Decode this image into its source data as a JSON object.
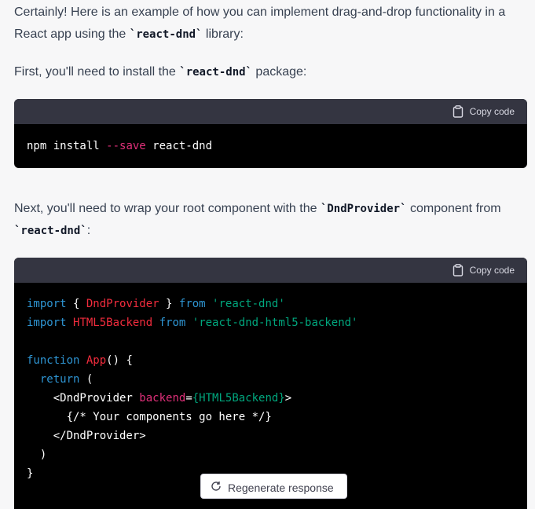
{
  "intro": {
    "before": "Certainly! Here is an example of how you can implement drag-and-drop functionality in a React app using the ",
    "lib": "`react-dnd`",
    "after": " library:"
  },
  "install": {
    "before": "First, you'll need to install the ",
    "lib": "`react-dnd`",
    "after": " package:"
  },
  "copy_label": "Copy code",
  "code1": {
    "cmd": "npm install ",
    "flag": "--save",
    "pkg": " react-dnd"
  },
  "wrap": {
    "before": "Next, you'll need to wrap your root component with the ",
    "comp": "`DndProvider`",
    "mid": " component from ",
    "lib": "`react-dnd`",
    "after": ":"
  },
  "code2": {
    "l1_import": "import",
    "l1_open": " { ",
    "l1_name": "DndProvider",
    "l1_close": " } ",
    "l1_from": "from",
    "l1_sp": " ",
    "l1_str": "'react-dnd'",
    "l2_import": "import",
    "l2_sp": " ",
    "l2_name": "HTML5Backend",
    "l2_sp2": " ",
    "l2_from": "from",
    "l2_sp3": " ",
    "l2_str": "'react-dnd-html5-backend'",
    "l4_function": "function",
    "l4_sp": " ",
    "l4_name": "App",
    "l4_rest": "() {",
    "l5_indent": "  ",
    "l5_return": "return",
    "l5_rest": " (",
    "l6_open": "    <DndProvider ",
    "l6_attr": "backend",
    "l6_eq": "=",
    "l6_val": "{HTML5Backend}",
    "l6_gt": ">",
    "l7": "      {/* Your components go here */}",
    "l8": "    </DndProvider>",
    "l9": "  )",
    "l10": "}"
  },
  "popup_label": "Regenerate response"
}
